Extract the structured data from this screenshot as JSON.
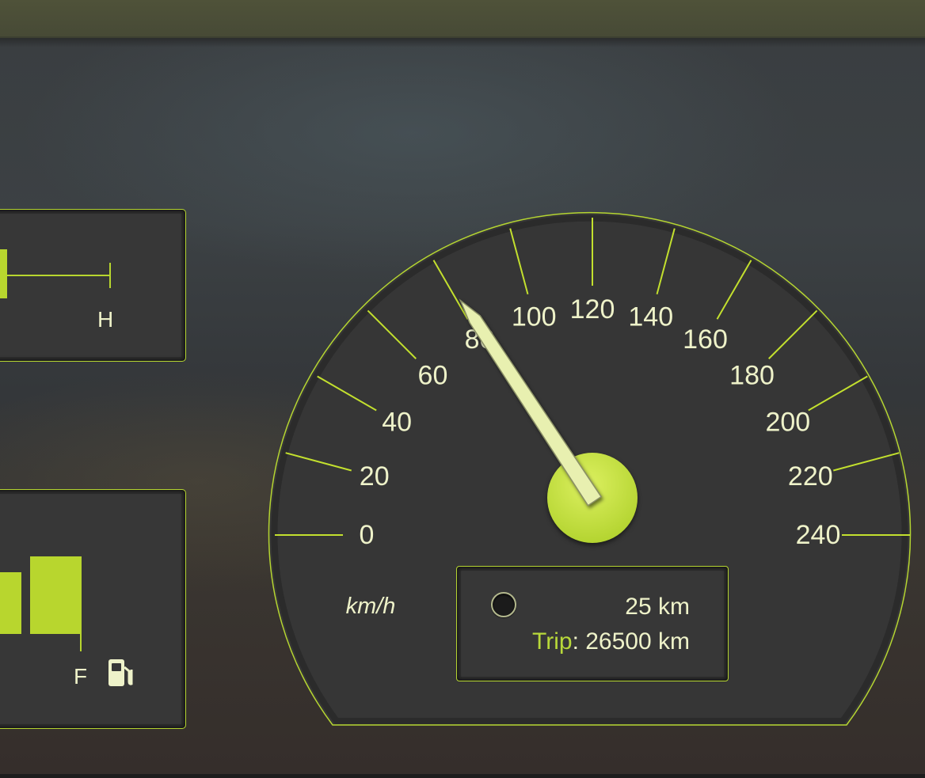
{
  "gauges": {
    "temperature": {
      "hot_label": "H",
      "level": 0.1
    },
    "fuel": {
      "full_label": "F",
      "icon": "fuel-pump-icon",
      "level": 0.9
    },
    "speedometer": {
      "unit": "km/h",
      "speed": 75,
      "max": 240,
      "tick_labels": [
        "0",
        "20",
        "40",
        "60",
        "80",
        "100",
        "120",
        "140",
        "160",
        "180",
        "200",
        "220",
        "240"
      ]
    }
  },
  "odometer": {
    "trip_km": "25 km",
    "total_label": "Trip",
    "total_separator": ":",
    "total_value": "26500 km",
    "reset_button": "trip-reset-button"
  },
  "colors": {
    "accent": "#c3e02e",
    "text": "#eef2c9",
    "panel": "#373737",
    "needle": "#e8f0b0"
  }
}
